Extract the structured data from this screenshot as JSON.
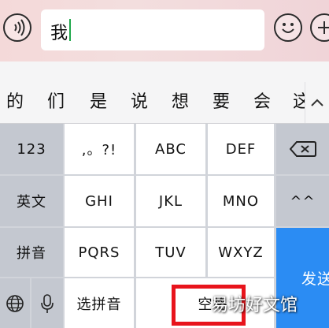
{
  "input": {
    "text": "我"
  },
  "candidates": [
    "的",
    "们",
    "是",
    "说",
    "想",
    "要",
    "会",
    "这"
  ],
  "keys": {
    "row1": {
      "left": "123",
      "k1": ",。?!",
      "k2": "ABC",
      "k3": "DEF"
    },
    "row2": {
      "left": "英文",
      "k1": "GHI",
      "k2": "JKL",
      "k3": "MNO",
      "right": "^^"
    },
    "row3": {
      "left": "拼音",
      "k1": "PQRS",
      "k2": "TUV",
      "k3": "WXYZ"
    },
    "row4": {
      "select_pinyin": "选拼音",
      "space": "空格"
    },
    "send": "发送"
  },
  "watermark": "易坊好文馆",
  "colors": {
    "send": "#2b8cf3",
    "highlight": "#e8141c",
    "caret": "#1fa84b"
  },
  "icons": {
    "voice": "voice-wave-icon",
    "emoji": "emoji-smile-icon",
    "plus": "plus-circle-icon",
    "backspace": "backspace-icon",
    "globe": "globe-icon",
    "mic": "microphone-icon",
    "chevron": "chevron-up-icon"
  }
}
